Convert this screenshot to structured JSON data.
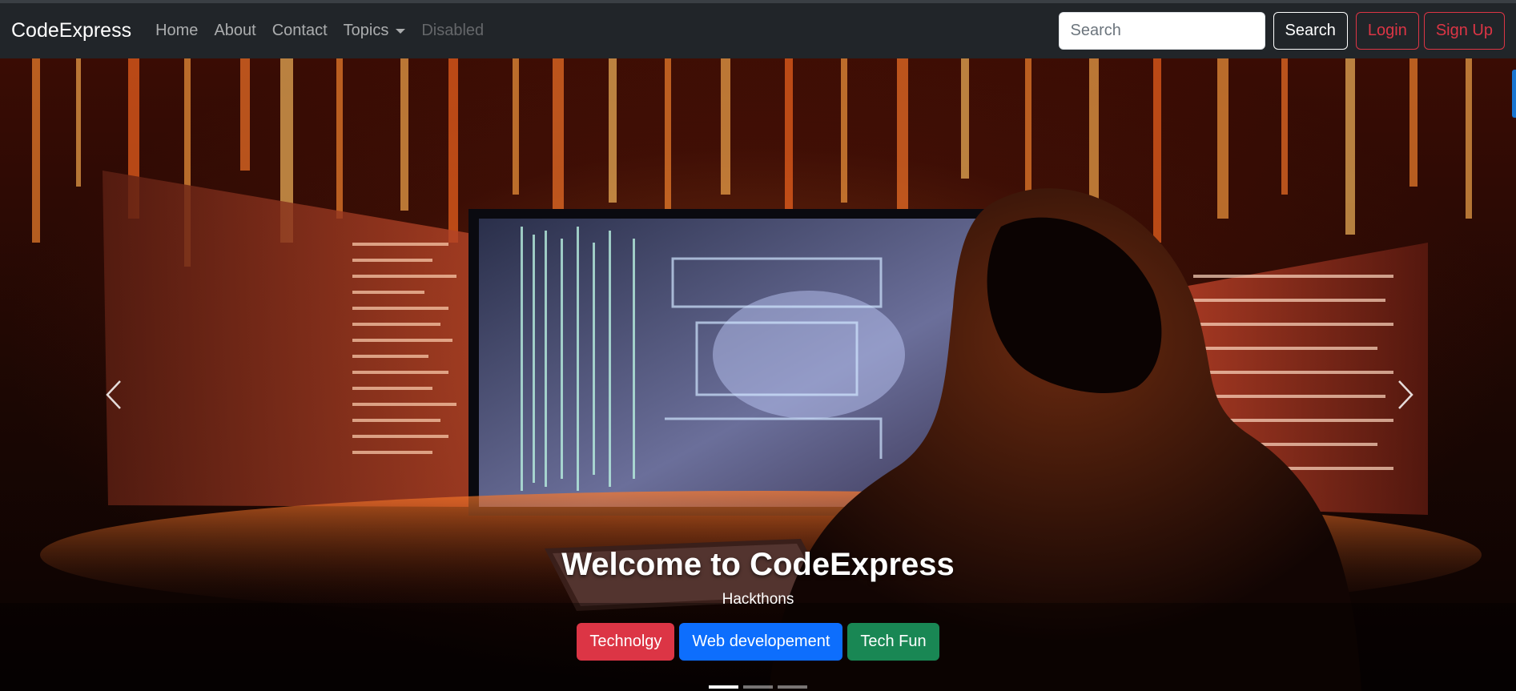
{
  "navbar": {
    "brand": "CodeExpress",
    "links": [
      {
        "label": "Home"
      },
      {
        "label": "About"
      },
      {
        "label": "Contact"
      },
      {
        "label": "Topics"
      },
      {
        "label": "Disabled"
      }
    ],
    "search": {
      "placeholder": "Search",
      "value": ""
    },
    "search_button": "Search",
    "login_button": "Login",
    "signup_button": "Sign Up"
  },
  "carousel": {
    "title": "Welcome to CodeExpress",
    "subtitle": "Hackthons",
    "buttons": [
      {
        "label": "Technolgy",
        "color": "#dc3545"
      },
      {
        "label": "Web developement",
        "color": "#0d6efd"
      },
      {
        "label": "Tech Fun",
        "color": "#198754"
      }
    ],
    "indicators": {
      "count": 3,
      "active_index": 0
    },
    "prev_icon": "chevron-left-icon",
    "next_icon": "chevron-right-icon"
  },
  "colors": {
    "navbar_bg": "#212529",
    "danger": "#dc3545",
    "primary": "#0d6efd",
    "success": "#198754"
  }
}
